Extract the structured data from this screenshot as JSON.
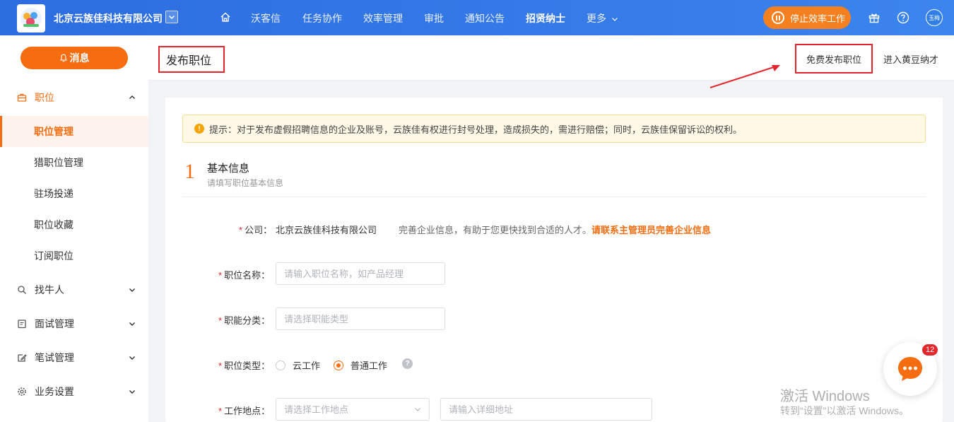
{
  "topbar": {
    "company": "北京云族佳科技有限公司",
    "nav": [
      "沃客信",
      "任务协作",
      "效率管理",
      "审批",
      "通知公告",
      "招贤纳士",
      "更多"
    ],
    "active_nav": "招贤纳士",
    "stop_button": "停止效率工作",
    "avatar": "玉梅",
    "icons": [
      "home-icon",
      "gift-icon",
      "help-icon"
    ],
    "brand_color": "#2c6de0"
  },
  "sidebar": {
    "message_button": "消息",
    "groups": [
      {
        "label": "职位",
        "icon": "briefcase-icon",
        "open": true
      },
      {
        "label": "找牛人",
        "icon": "search-icon"
      },
      {
        "label": "面试管理",
        "icon": "calendar-icon"
      },
      {
        "label": "笔试管理",
        "icon": "edit-icon"
      },
      {
        "label": "业务设置",
        "icon": "gear-icon"
      }
    ],
    "sub_items": [
      "职位管理",
      "猎职位管理",
      "驻场投递",
      "职位收藏",
      "订阅职位"
    ],
    "active_sub": "职位管理",
    "accent_color": "#f56d10"
  },
  "header": {
    "title": "发布职位",
    "free_post": "免费发布职位",
    "enter_link": "进入黄豆纳才"
  },
  "tip": "提示：对于发布虚假招聘信息的企业及账号，云族佳有权进行封号处理，造成损失的，需进行赔偿；同时，云族佳保留诉讼的权利。",
  "section": {
    "number": "1",
    "title": "基本信息",
    "subtitle": "请填写职位基本信息"
  },
  "form": {
    "company_label": "公司",
    "company_value": "北京云族佳科技有限公司",
    "company_hint": "完善企业信息，有助于您更快找到合适的人才。",
    "company_link": "请联系主管理员完善企业信息",
    "job_name_label": "职位名称",
    "job_name_placeholder": "请输入职位名称，如产品经理",
    "job_category_label": "职能分类",
    "job_category_placeholder": "请选择职能类型",
    "job_type_label": "职位类型",
    "job_type_options": [
      "云工作",
      "普通工作"
    ],
    "job_type_selected": "普通工作",
    "location_label": "工作地点",
    "location_placeholder": "请选择工作地点",
    "address_placeholder": "请输入详细地址"
  },
  "chat_badge": "12",
  "watermark": {
    "line1": "激活 Windows",
    "line2": "转到“设置”以激活 Windows。"
  }
}
